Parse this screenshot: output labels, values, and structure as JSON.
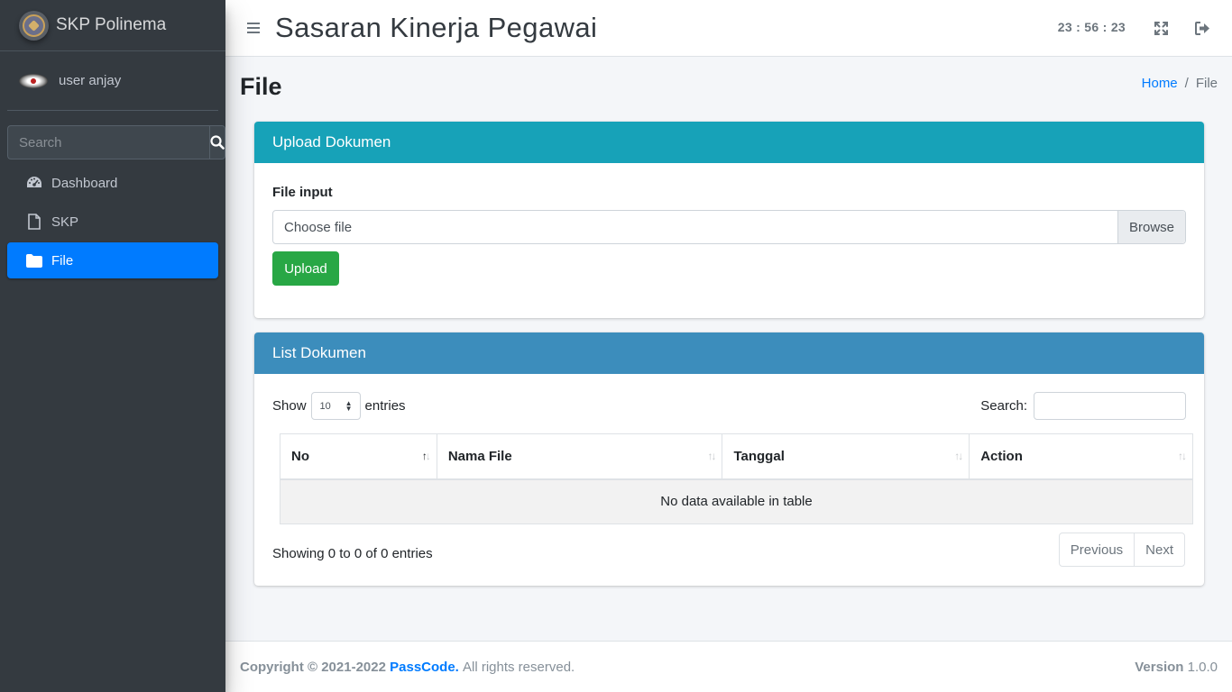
{
  "app": {
    "brand": "SKP Polinema",
    "user_name": "user anjay"
  },
  "sidebar": {
    "search_placeholder": "Search",
    "items": [
      {
        "label": "Dashboard",
        "icon": "tachometer-icon"
      },
      {
        "label": "SKP",
        "icon": "file-icon"
      },
      {
        "label": "File",
        "icon": "folder-icon",
        "active": true
      }
    ]
  },
  "header": {
    "title": "Sasaran Kinerja Pegawai",
    "clock": "23 : 56 : 23"
  },
  "page": {
    "title": "File",
    "breadcrumb_home": "Home",
    "breadcrumb_separator": "/",
    "breadcrumb_current": "File"
  },
  "upload_card": {
    "title": "Upload Dokumen",
    "file_label": "File input",
    "file_placeholder": "Choose file",
    "browse_label": "Browse",
    "upload_label": "Upload"
  },
  "list_card": {
    "title": "List Dokumen",
    "show_label": "Show",
    "entries_value": "10",
    "entries_label": "entries",
    "search_label": "Search:",
    "columns": [
      "No",
      "Nama File",
      "Tanggal",
      "Action"
    ],
    "empty_text": "No data available in table",
    "info_text": "Showing 0 to 0 of 0 entries",
    "prev_label": "Previous",
    "next_label": "Next"
  },
  "footer": {
    "copyright_prefix": "Copyright © 2021-2022",
    "copyright_brand": "PassCode.",
    "copyright_suffix": "All rights reserved.",
    "version_label": "Version",
    "version_value": "1.0.0"
  },
  "colors": {
    "sidebar": "#343a40",
    "active": "#007bff",
    "upload_header": "#17a2b8",
    "list_header": "#3c8dbc",
    "upload_button": "#28a745"
  }
}
